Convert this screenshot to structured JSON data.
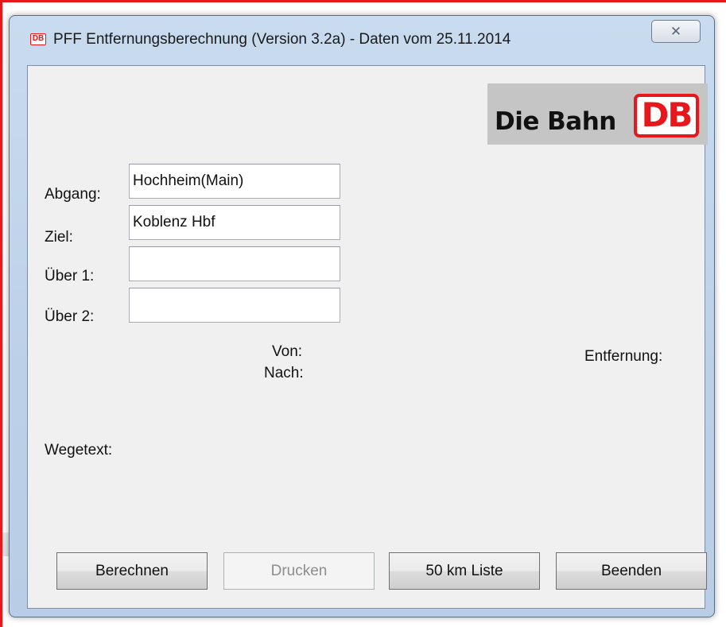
{
  "window": {
    "title": "PFF Entfernungsberechnung (Version 3.2a) - Daten vom 25.11.2014",
    "app_icon_text": "DB",
    "close_symbol": "✕"
  },
  "logo": {
    "text": "Die Bahn",
    "badge": "DB"
  },
  "form": {
    "abgang_label": "Abgang:",
    "abgang_value": "Hochheim(Main)",
    "ziel_label": "Ziel:",
    "ziel_value": "Koblenz Hbf",
    "ueber1_label": "Über 1:",
    "ueber1_value": "",
    "ueber2_label": "Über 2:",
    "ueber2_value": ""
  },
  "info": {
    "von_label": "Von:",
    "nach_label": "Nach:",
    "entfernung_label": "Entfernung:",
    "wegetext_label": "Wegetext:"
  },
  "buttons": {
    "berechnen": "Berechnen",
    "drucken": "Drucken",
    "liste": "50 km Liste",
    "beenden": "Beenden"
  },
  "colors": {
    "brand_red": "#e8171c",
    "client_bg": "#f0f0f0",
    "frame_blue": "#bcd0e8"
  }
}
